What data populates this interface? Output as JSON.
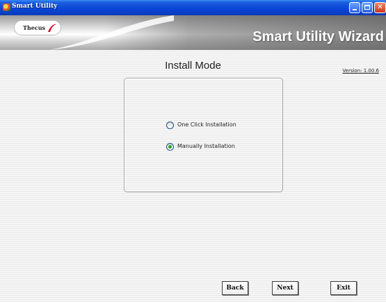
{
  "window": {
    "title": "Smart Utility"
  },
  "banner": {
    "logo_text": "Thecus",
    "title": "Smart Utility Wizard"
  },
  "page": {
    "heading": "Install Mode",
    "version": "Version: 1.00.6"
  },
  "install_options": [
    {
      "label": "One Click Installation",
      "selected": false
    },
    {
      "label": "Manually Installation",
      "selected": true
    }
  ],
  "buttons": {
    "back": "Back",
    "next": "Next",
    "exit": "Exit"
  },
  "colors": {
    "titlebar": "#0a46d8",
    "radio_selected": "#2aa52a"
  },
  "icons": {
    "app": "app-icon",
    "minimize": "minimize-icon",
    "maximize": "maximize-icon",
    "close": "close-icon"
  }
}
